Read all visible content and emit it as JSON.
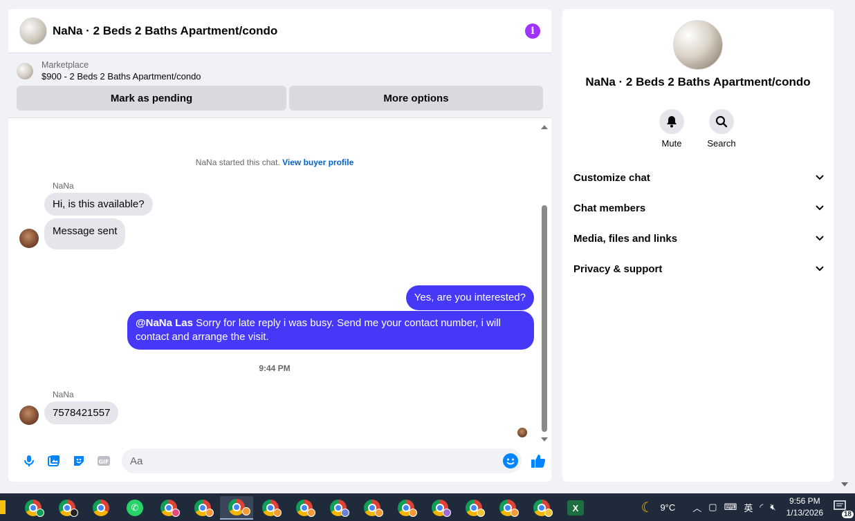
{
  "chat": {
    "title": "NaNa · 2 Beds 2 Baths Apartment/condo",
    "marketplace": {
      "label": "Marketplace",
      "listing": "$900 - 2 Beds 2 Baths Apartment/condo",
      "mark_pending": "Mark as pending",
      "more_options": "More options"
    },
    "system_note": "NaNa started this chat.",
    "system_link": "View buyer profile",
    "messages": {
      "sender1": "NaNa",
      "in1": "Hi, is this available?",
      "in2": "Message sent",
      "out1": "Yes, are you interested?",
      "out2_mention": "@NaNa Las",
      "out2_text": " Sorry for late reply i was busy. Send me your contact number, i will contact and arrange the visit.",
      "time": "9:44 PM",
      "sender2": "NaNa",
      "in3": "7578421557"
    },
    "composer": {
      "placeholder": "Aa"
    }
  },
  "info": {
    "name": "NaNa · 2 Beds 2 Baths Apartment/condo",
    "actions": {
      "mute": "Mute",
      "search": "Search"
    },
    "sections": [
      "Customize chat",
      "Chat members",
      "Media, files and links",
      "Privacy & support"
    ]
  },
  "taskbar": {
    "weather": "9°C",
    "time": "9:56 PM",
    "date": "1/13/2026",
    "notifications": "18"
  },
  "colors": {
    "outgoing_bubble": "#4538f7",
    "accent_blue": "#0084ff",
    "info_purple": "#a033ff"
  }
}
